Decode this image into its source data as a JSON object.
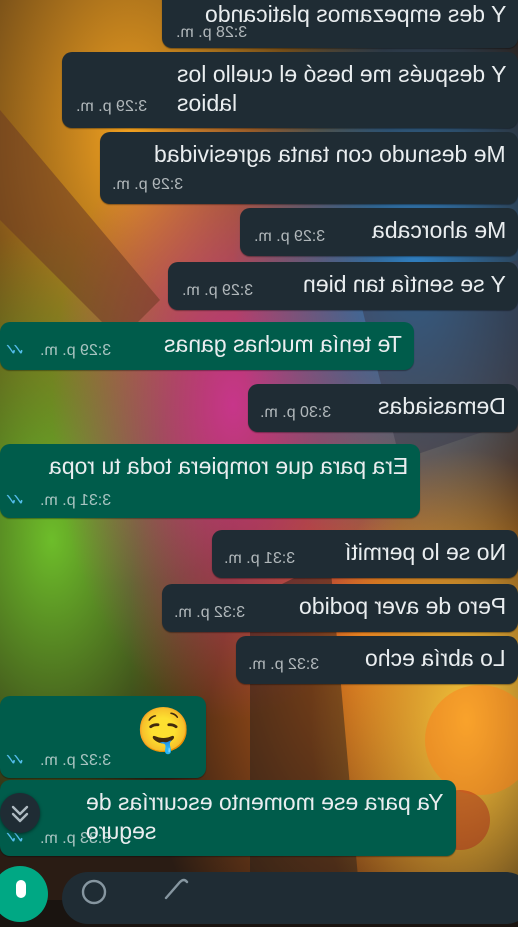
{
  "messages": [
    {
      "text": "Y des empezamos platicando",
      "time": "3:28 p. m.",
      "dir": "in"
    },
    {
      "text": "Y después me besó el cuello los\nlabios",
      "time": "3:29 p. m.",
      "dir": "in"
    },
    {
      "text": "Me desnudo con tanta agresividad",
      "time": "3:29 p. m.",
      "dir": "in"
    },
    {
      "text": "Me ahorcaba",
      "time": "3:29 p. m.",
      "dir": "in"
    },
    {
      "text": "Y se sentía tan bien",
      "time": "3:29 p. m.",
      "dir": "in"
    },
    {
      "text": "Te tenía muchas ganas",
      "time": "3:29 p. m.",
      "dir": "out"
    },
    {
      "text": "Demasiadas",
      "time": "3:30 p. m.",
      "dir": "in"
    },
    {
      "text": "Era para que rompiera toda tu ropa",
      "time": "3:31 p. m.",
      "dir": "out"
    },
    {
      "text": "No se lo permití",
      "time": "3:31 p. m.",
      "dir": "in"
    },
    {
      "text": "Pero de aver podido",
      "time": "3:32 p. m.",
      "dir": "in"
    },
    {
      "text": "Lo abría echo",
      "time": "3:32 p. m.",
      "dir": "in"
    },
    {
      "text": "🤤",
      "time": "3:32 p. m.",
      "dir": "out"
    },
    {
      "text": "Ya para ese momento escurrías de\nseguro",
      "time": "3:33 p. m.",
      "dir": "out"
    }
  ],
  "icons": {
    "read_receipt": "double-check-icon",
    "scroll": "chevron-double-down-icon",
    "mic": "mic-icon",
    "emoji": "emoji-icon",
    "attach": "paperclip-icon"
  },
  "colors": {
    "incoming_bubble": "#1f2c34",
    "outgoing_bubble": "#005c4b",
    "read_tick": "#53bdeb",
    "accent": "#00a884"
  }
}
